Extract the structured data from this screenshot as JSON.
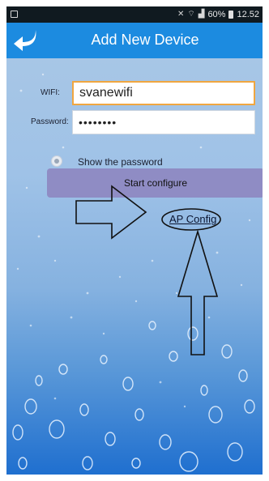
{
  "status_bar": {
    "battery_percent": "60%",
    "time": "12.52",
    "icons": [
      "image-notification-icon",
      "mute-icon",
      "wifi-icon",
      "signal-icon",
      "battery-icon"
    ]
  },
  "header": {
    "title": "Add New Device",
    "back_icon": "back-arrow-icon",
    "color": "#1c8be0"
  },
  "form": {
    "wifi_label": "WIFI:",
    "wifi_value": "svanewifi",
    "password_label": "Password:",
    "password_value": "••••••••",
    "show_password_label": "Show the password",
    "show_password_checked": false
  },
  "actions": {
    "start_configure_label": "Start configure",
    "ap_config_label": "AP Config"
  },
  "annotations": {
    "arrows": [
      "right-pointing-arrow",
      "up-pointing-arrow"
    ],
    "highlight": "ellipse-around-ap-config"
  },
  "colors": {
    "accent": "#1c8be0",
    "input_focus_border": "#f0a640",
    "button": "#8f8cc4"
  }
}
